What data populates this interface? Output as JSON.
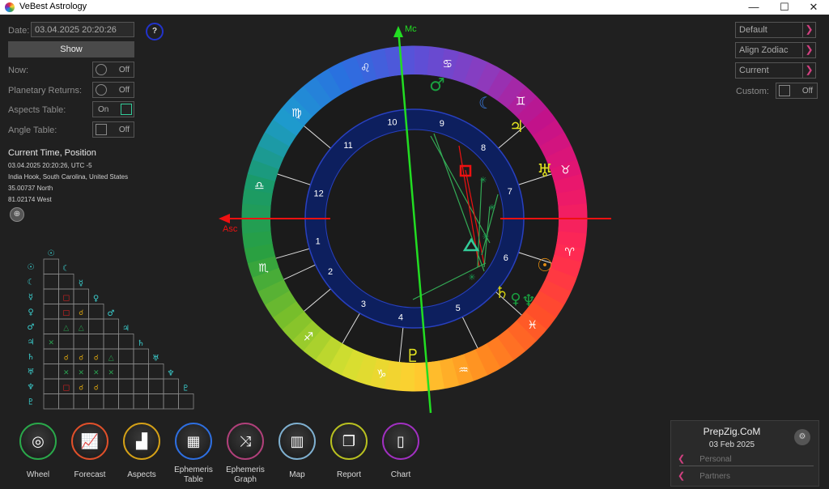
{
  "window": {
    "title": "VeBest Astrology",
    "minimize": "—",
    "maximize": "☐",
    "close": "✕"
  },
  "controls": {
    "date_label": "Date:",
    "date_value": "03.04.2025 20:20:26",
    "show_label": "Show",
    "help_label": "?",
    "now_label": "Now:",
    "now_state": "Off",
    "returns_label": "Planetary Returns:",
    "returns_state": "Off",
    "aspects_table_label": "Aspects Table:",
    "aspects_table_state": "On",
    "angle_table_label": "Angle Table:",
    "angle_table_state": "Off"
  },
  "info": {
    "title": "Current Time, Position",
    "datetime": "03.04.2025 20:20:26, UTC -5",
    "place": "India Hook, South Carolina, United States",
    "latitude": "35.00737 North",
    "longitude": "81.02174 West"
  },
  "right_controls": {
    "default_label": "Default",
    "align_label": "Align Zodiac",
    "current_label": "Current",
    "custom_label": "Custom:",
    "custom_state": "Off"
  },
  "chart": {
    "mc_label": "Mc",
    "asc_label": "Asc",
    "house_numbers": [
      "1",
      "2",
      "3",
      "4",
      "5",
      "6",
      "7",
      "8",
      "9",
      "10",
      "11",
      "12"
    ],
    "zodiac_glyphs": [
      "♈",
      "♉",
      "♊",
      "♋",
      "♌",
      "♍",
      "♎",
      "♏",
      "♐",
      "♑",
      "♒",
      "♓"
    ],
    "planet_glyphs": {
      "mars": "♂",
      "moon": "☾",
      "jupiter": "♃",
      "uranus": "♅",
      "sun": "☉",
      "saturn": "♄",
      "venus": "♀",
      "neptune": "♆",
      "pluto": "♇"
    },
    "colors": {
      "mc": "#22dd22",
      "asc": "#ee1111",
      "inner_ring": "#0d1f5e",
      "trine": "#33aa55",
      "square": "#ee1111"
    }
  },
  "aspect_table": {
    "planet_glyphs": [
      "☉",
      "☾",
      "☿",
      "♀",
      "♂",
      "♃",
      "♄",
      "♅",
      "♆",
      "♇"
    ],
    "cells": [
      [
        "",
        "",
        "",
        "",
        "",
        "",
        "",
        "",
        "",
        ""
      ],
      [
        "",
        "",
        "",
        "",
        "",
        "",
        "",
        "",
        "",
        ""
      ],
      [
        "",
        "□",
        "",
        "",
        "",
        "",
        "",
        "",
        "",
        ""
      ],
      [
        "",
        "□",
        "☌",
        "",
        "",
        "",
        "",
        "",
        "",
        ""
      ],
      [
        "",
        "△",
        "△",
        "",
        "",
        "",
        "",
        "",
        "",
        ""
      ],
      [
        "✕",
        "",
        "",
        "",
        "",
        "",
        "",
        "",
        "",
        ""
      ],
      [
        "",
        "☌",
        "☌",
        "☌",
        "△",
        "",
        "",
        "",
        "",
        ""
      ],
      [
        "",
        "✕",
        "✕",
        "✕",
        "✕",
        "",
        "",
        "",
        "",
        ""
      ],
      [
        "",
        "□",
        "☌",
        "☌",
        "",
        "",
        "",
        "",
        "",
        ""
      ],
      [
        "",
        "",
        "",
        "",
        "",
        "",
        "",
        "",
        "",
        ""
      ]
    ]
  },
  "nav": [
    {
      "label": "Wheel",
      "color": "#2aa84a",
      "icon": "wheel-icon"
    },
    {
      "label": "Forecast",
      "color": "#e0502a",
      "icon": "forecast-icon"
    },
    {
      "label": "Aspects",
      "color": "#d4a017",
      "icon": "aspects-icon"
    },
    {
      "label": "Ephemeris Table",
      "color": "#2e6fe0",
      "icon": "ephemeris-table-icon"
    },
    {
      "label": "Ephemeris Graph",
      "color": "#b0407a",
      "icon": "ephemeris-graph-icon"
    },
    {
      "label": "Map",
      "color": "#7fb0d0",
      "icon": "map-icon"
    },
    {
      "label": "Report",
      "color": "#b8c020",
      "icon": "report-icon"
    },
    {
      "label": "Chart",
      "color": "#a030c0",
      "icon": "chart-icon"
    }
  ],
  "profile_panel": {
    "site": "PrepZig.CoM",
    "date": "03 Feb 2025",
    "personal_label": "Personal",
    "partners_label": "Partners"
  }
}
